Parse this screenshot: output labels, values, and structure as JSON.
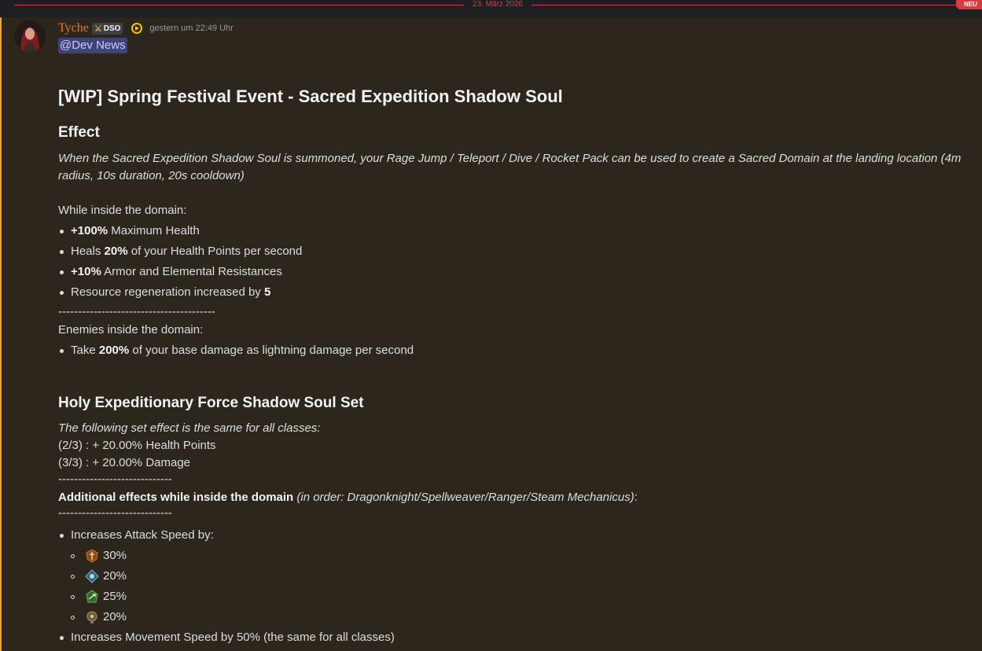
{
  "divider": {
    "date": "23. März 2026",
    "badge": "NEU"
  },
  "message": {
    "author": "Tyche",
    "role_badge": "DSO",
    "timestamp": "gestern um 22:49 Uhr",
    "mention": "@Dev News"
  },
  "post": {
    "title": "[WIP] Spring Festival Event - Sacred Expedition Shadow Soul",
    "effect_heading": "Effect",
    "effect_desc": "When the Sacred Expedition Shadow Soul is summoned, your Rage Jump / Teleport / Dive / Rocket Pack can be used to create a Sacred Domain at the landing location (4m radius, 10s duration, 20s cooldown)",
    "inside_label": "While inside the domain:",
    "inside_bullets": [
      {
        "bold": "+100%",
        "text": " Maximum Health"
      },
      {
        "pre": "Heals ",
        "bold": "20%",
        "text": " of your Health Points per second"
      },
      {
        "bold": "+10%",
        "text": " Armor and Elemental Resistances"
      },
      {
        "pre": "Resource regeneration increased by ",
        "bold": "5",
        "text": ""
      }
    ],
    "separator_long": "----------------------------------------",
    "enemies_label": "Enemies inside the domain:",
    "enemies_bullet": {
      "pre": "Take ",
      "bold": "200%",
      "text": " of your base damage as lightning damage per second"
    },
    "set_heading": "Holy Expeditionary Force Shadow Soul Set",
    "set_note": "The following set effect is the same for all classes:",
    "set_2": "(2/3) :  + 20.00% Health Points",
    "set_3": "(3/3) :  + 20.00% Damage",
    "separator_short": "-----------------------------",
    "additional_bold": "Additional effects while inside the domain",
    "additional_ital": " (in order: Dragonknight/Spellweaver/Ranger/Steam Mechanicus)",
    "additional_colon": ":",
    "attack_speed_label": "Increases Attack Speed by:",
    "attack_speed_values": [
      "30%",
      "20%",
      "25%",
      "20%"
    ],
    "movement_label": "Increases Movement Speed by 50% (the same for all classes)"
  },
  "icons": {
    "class_icons": [
      "dragonknight-icon",
      "spellweaver-icon",
      "ranger-icon",
      "steam-mechanicus-icon"
    ]
  },
  "colors": {
    "accent": "#e5a936",
    "author": "#e8772c",
    "divider": "#c9404a",
    "message_bg": "#2c261d"
  }
}
